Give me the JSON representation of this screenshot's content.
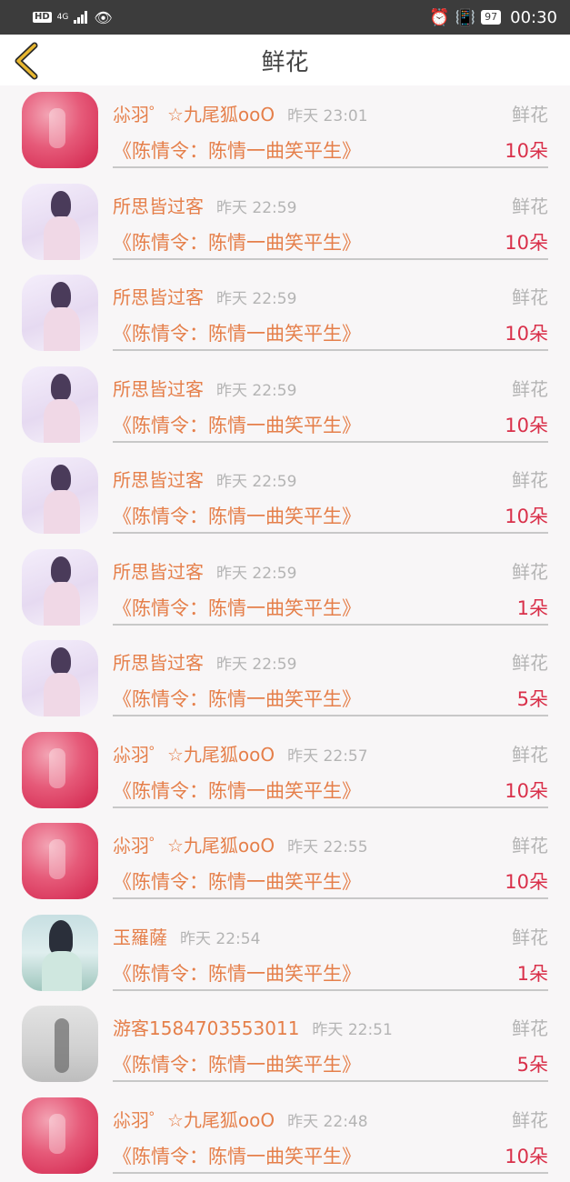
{
  "status_bar": {
    "left_labels": {
      "hd": "HD",
      "network": "4G"
    },
    "battery": "97",
    "time": "00:30"
  },
  "header": {
    "title": "鲜花",
    "back_icon": "chevron-left-icon",
    "accent_color": "#e8b730"
  },
  "colors": {
    "name": "#e57f4a",
    "muted": "#b4b4b4",
    "count": "#d9304a"
  },
  "rows": [
    {
      "avatar": "red",
      "name": "尛羽゜☆九尾狐ooO",
      "time": "昨天 23:01",
      "type": "鲜花",
      "book": "《陈情令：陈情一曲笑平生》",
      "count": "10朵"
    },
    {
      "avatar": "girl",
      "name": "所思皆过客",
      "time": "昨天 22:59",
      "type": "鲜花",
      "book": "《陈情令：陈情一曲笑平生》",
      "count": "10朵"
    },
    {
      "avatar": "girl",
      "name": "所思皆过客",
      "time": "昨天 22:59",
      "type": "鲜花",
      "book": "《陈情令：陈情一曲笑平生》",
      "count": "10朵"
    },
    {
      "avatar": "girl",
      "name": "所思皆过客",
      "time": "昨天 22:59",
      "type": "鲜花",
      "book": "《陈情令：陈情一曲笑平生》",
      "count": "10朵"
    },
    {
      "avatar": "girl",
      "name": "所思皆过客",
      "time": "昨天 22:59",
      "type": "鲜花",
      "book": "《陈情令：陈情一曲笑平生》",
      "count": "10朵"
    },
    {
      "avatar": "girl",
      "name": "所思皆过客",
      "time": "昨天 22:59",
      "type": "鲜花",
      "book": "《陈情令：陈情一曲笑平生》",
      "count": "1朵"
    },
    {
      "avatar": "girl",
      "name": "所思皆过客",
      "time": "昨天 22:59",
      "type": "鲜花",
      "book": "《陈情令：陈情一曲笑平生》",
      "count": "5朵"
    },
    {
      "avatar": "red",
      "name": "尛羽゜☆九尾狐ooO",
      "time": "昨天 22:57",
      "type": "鲜花",
      "book": "《陈情令：陈情一曲笑平生》",
      "count": "10朵"
    },
    {
      "avatar": "red",
      "name": "尛羽゜☆九尾狐ooO",
      "time": "昨天 22:55",
      "type": "鲜花",
      "book": "《陈情令：陈情一曲笑平生》",
      "count": "10朵"
    },
    {
      "avatar": "jade",
      "name": "玉羅薩",
      "time": "昨天 22:54",
      "type": "鲜花",
      "book": "《陈情令：陈情一曲笑平生》",
      "count": "1朵"
    },
    {
      "avatar": "gray",
      "name": "游客1584703553011",
      "time": "昨天 22:51",
      "type": "鲜花",
      "book": "《陈情令：陈情一曲笑平生》",
      "count": "5朵"
    },
    {
      "avatar": "red",
      "name": "尛羽゜☆九尾狐ooO",
      "time": "昨天 22:48",
      "type": "鲜花",
      "book": "《陈情令：陈情一曲笑平生》",
      "count": "10朵"
    }
  ]
}
